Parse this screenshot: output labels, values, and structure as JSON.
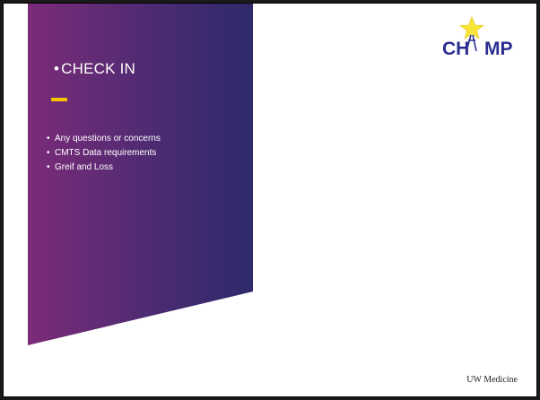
{
  "slide": {
    "title_bullet": "•",
    "title": "CHECK IN",
    "bullets": [
      "Any questions or concerns",
      "CMTS Data requirements",
      "Greif and Loss"
    ],
    "bullet_glyph": "•",
    "logo": {
      "text_left": "CH",
      "text_right": "MP",
      "icon": "star-figure-icon"
    },
    "footer": "UW Medicine"
  },
  "colors": {
    "gradient_start": "#7a2a78",
    "gradient_end": "#2f2a6a",
    "accent": "#f5c400",
    "logo_text": "#2b2e8f",
    "star": "#f7e53a"
  }
}
